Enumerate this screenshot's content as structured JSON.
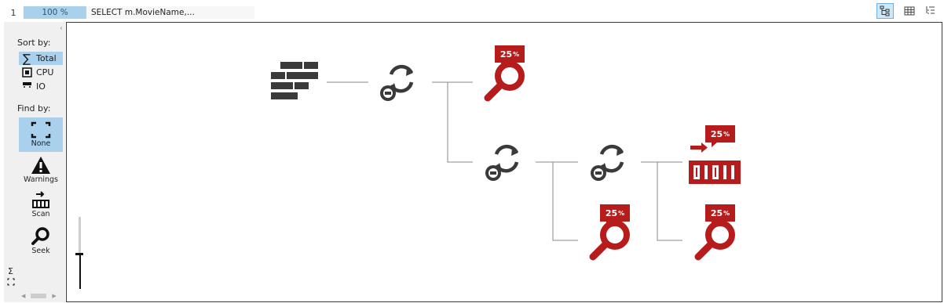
{
  "header": {
    "statement_number": "1",
    "statement_cost": "100 %",
    "statement_text": "SELECT m.MovieName,..."
  },
  "view_buttons": [
    {
      "name": "plan-tree-view",
      "icon": "plan-tree-icon",
      "active": true
    },
    {
      "name": "grid-view",
      "icon": "grid-icon",
      "active": false
    },
    {
      "name": "list-view",
      "icon": "tree-list-icon",
      "active": false
    }
  ],
  "sidebar": {
    "sort_label": "Sort by:",
    "sort_items": [
      {
        "label": "Total",
        "icon": "sigma-icon",
        "active": true
      },
      {
        "label": "CPU",
        "icon": "cpu-icon",
        "active": false
      },
      {
        "label": "IO",
        "icon": "io-icon",
        "active": false
      }
    ],
    "find_label": "Find by:",
    "find_items": [
      {
        "label": "None",
        "icon": "none-brackets-icon",
        "active": true
      },
      {
        "label": "Warnings",
        "icon": "warning-icon",
        "active": false
      },
      {
        "label": "Scan",
        "icon": "scan-icon",
        "active": false
      },
      {
        "label": "Seek",
        "icon": "seek-icon",
        "active": false
      }
    ],
    "mini_sort_symbol": "Σ"
  },
  "plan": {
    "accent_color": "#b71c1c",
    "operator_color": "#3a3a3a",
    "nodes": [
      {
        "type": "select",
        "icon": "select-icon",
        "cost": ""
      },
      {
        "type": "nested-loops",
        "icon": "nested-loops-icon",
        "cost": ""
      },
      {
        "type": "index-seek",
        "icon": "seek-icon",
        "cost": "25",
        "cost_unit": "%"
      },
      {
        "type": "nested-loops",
        "icon": "nested-loops-icon",
        "cost": ""
      },
      {
        "type": "nested-loops",
        "icon": "nested-loops-icon",
        "cost": ""
      },
      {
        "type": "index-scan",
        "icon": "scan-icon",
        "cost": "25",
        "cost_unit": "%"
      },
      {
        "type": "index-seek",
        "icon": "seek-icon",
        "cost": "25",
        "cost_unit": "%"
      },
      {
        "type": "index-seek",
        "icon": "seek-icon",
        "cost": "25",
        "cost_unit": "%"
      }
    ]
  }
}
